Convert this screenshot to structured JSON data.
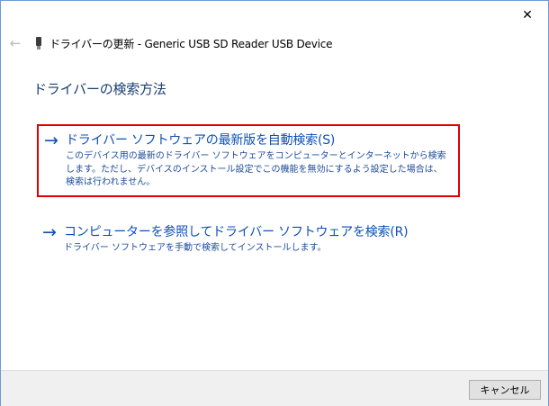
{
  "window": {
    "title": "ドライバーの更新 - Generic USB  SD Reader USB Device",
    "close_glyph": "✕",
    "back_glyph": "←"
  },
  "main": {
    "heading": "ドライバーの検索方法",
    "options": [
      {
        "arrow": "→",
        "title": "ドライバー ソフトウェアの最新版を自動検索(S)",
        "description": "このデバイス用の最新のドライバー ソフトウェアをコンピューターとインターネットから検索します。ただし、デバイスのインストール設定でこの機能を無効にするよう設定した場合は、検索は行われません。",
        "selected": true
      },
      {
        "arrow": "→",
        "title": "コンピューターを参照してドライバー ソフトウェアを検索(R)",
        "description": "ドライバー ソフトウェアを手動で検索してインストールします。",
        "selected": false
      }
    ]
  },
  "footer": {
    "cancel_label": "キャンセル"
  },
  "colors": {
    "link_blue": "#0c50b8",
    "heading_blue": "#1a3e72",
    "selection_red": "#e00000",
    "footer_bg": "#f0f0f0"
  },
  "icons": {
    "back": "back-arrow-icon",
    "device": "usb-device-icon",
    "close": "close-icon",
    "option_arrow": "right-arrow-icon"
  }
}
